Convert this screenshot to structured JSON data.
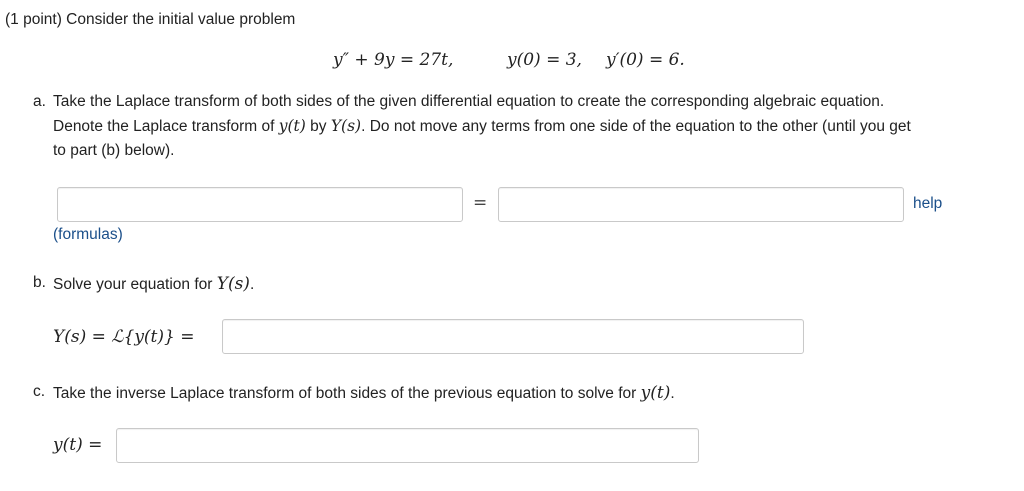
{
  "problem": {
    "header": "(1 point) Consider the initial value problem",
    "equation": {
      "ode_lhs_a": "y″",
      "ode_lhs_b": " + 9y = 27t,",
      "ic1": "y(0) = 3,",
      "ic2": "y′(0) = 6."
    }
  },
  "part_a": {
    "label": "a.",
    "line1": "Take the Laplace transform of both sides of the given differential equation to create the corresponding algebraic equation.",
    "line2_a": "Denote the Laplace transform of ",
    "line2_y": "y(t)",
    "line2_b": " by ",
    "line2_Y": "Y(s)",
    "line2_c": ". Do not move any terms from one side of the equation to the other (until you get",
    "line3": "to part (b) below).",
    "left_input_value": "",
    "equals": "=",
    "right_input_value": "",
    "help_link": "help",
    "formulas_link": "(formulas)"
  },
  "part_b": {
    "label": "b.",
    "text": "Solve your equation for ",
    "text_Y": "Y(s)",
    "text_end": ".",
    "answer_prefix": "Y(s) = ℒ{y(t)} =",
    "input_value": ""
  },
  "part_c": {
    "label": "c.",
    "text": "Take the inverse Laplace transform of both sides of the previous equation to solve for ",
    "text_y": "y(t)",
    "text_end": ".",
    "answer_prefix": "y(t) =",
    "input_value": ""
  }
}
